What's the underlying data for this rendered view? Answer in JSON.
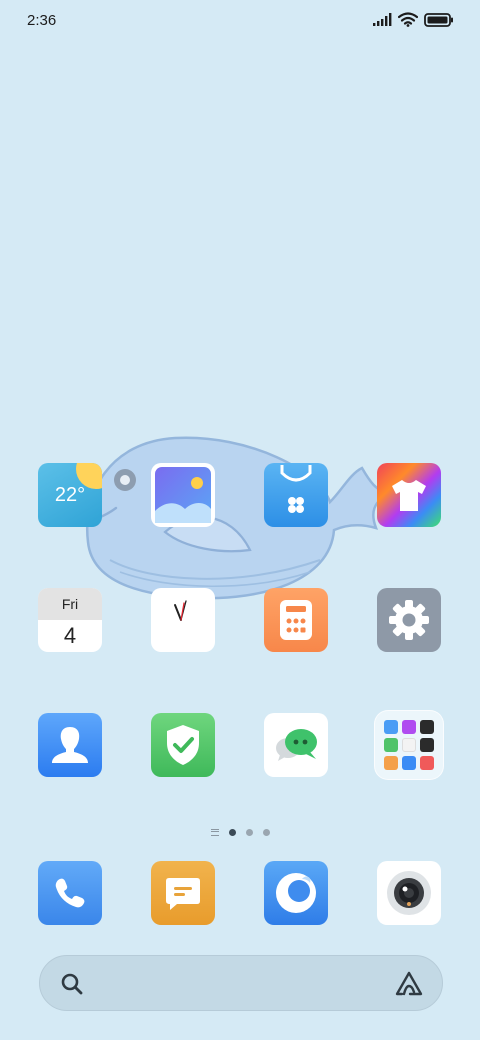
{
  "status_bar": {
    "time": "2:36",
    "icons": [
      "signal-icon",
      "wifi-icon",
      "battery-icon"
    ]
  },
  "apps": {
    "weather": {
      "temperature": "22°",
      "icon": "weather-icon"
    },
    "gallery": {
      "icon": "gallery-icon"
    },
    "app_store": {
      "icon": "app-store-icon"
    },
    "themes": {
      "icon": "themes-icon"
    },
    "calendar": {
      "weekday": "Fri",
      "day": "4",
      "icon": "calendar-icon"
    },
    "clock": {
      "icon": "clock-icon"
    },
    "calculator": {
      "icon": "calculator-icon"
    },
    "settings": {
      "icon": "gear-icon"
    },
    "contacts": {
      "icon": "contacts-icon"
    },
    "security": {
      "icon": "shield-check-icon"
    },
    "messenger": {
      "icon": "chat-bubbles-icon"
    },
    "folder": {
      "icon": "folder-icon",
      "mini_app_colors": [
        "#4a9df5",
        "#b04cf0",
        "#2b2b2b",
        "#4fc36a",
        "#f05050",
        "#e8404a",
        "#f4a04a",
        "#3b8cf5",
        "#f05a5a"
      ]
    }
  },
  "page_indicator": {
    "pages": 3,
    "active_index": 0
  },
  "dock": {
    "phone": {
      "icon": "phone-icon"
    },
    "messages": {
      "icon": "message-icon"
    },
    "browser": {
      "icon": "browser-icon"
    },
    "camera": {
      "icon": "camera-icon"
    }
  },
  "search_bar": {
    "left_icon": "search-icon",
    "right_icon": "assistant-icon"
  },
  "colors": {
    "background": "#d5eaf5",
    "accent": "#3b86ea"
  }
}
